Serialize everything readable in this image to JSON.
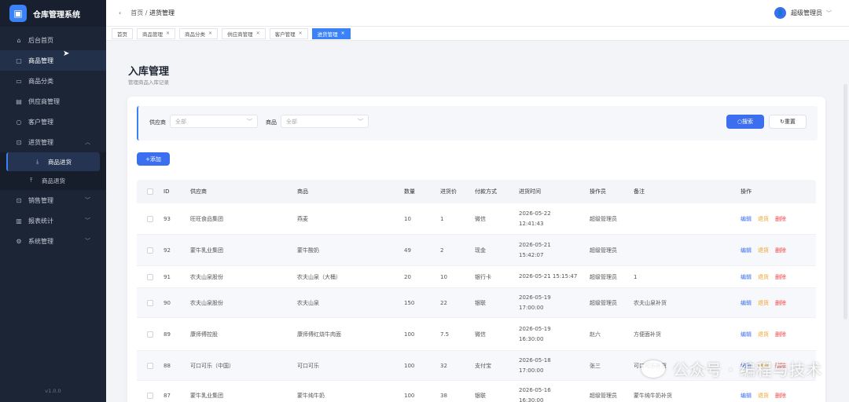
{
  "app": {
    "title": "仓库管理系统",
    "version": "v1.0.0"
  },
  "sidebar": {
    "items": [
      {
        "label": "后台首页",
        "icon": "home-icon"
      },
      {
        "label": "商品管理",
        "icon": "bag-icon"
      },
      {
        "label": "商品分类",
        "icon": "folder-icon"
      },
      {
        "label": "供应商管理",
        "icon": "truck-icon"
      },
      {
        "label": "客户管理",
        "icon": "user-icon"
      },
      {
        "label": "进货管理",
        "icon": "cart-icon"
      },
      {
        "label": "销售管理",
        "icon": "cart-icon"
      },
      {
        "label": "报表统计",
        "icon": "chart-icon"
      },
      {
        "label": "系统管理",
        "icon": "gear-icon"
      }
    ],
    "subitems": [
      {
        "label": "商品进货",
        "icon": "download-icon"
      },
      {
        "label": "商品退货",
        "icon": "upload-icon"
      }
    ]
  },
  "header": {
    "breadcrumb_home": "首页",
    "breadcrumb_sep": "/",
    "breadcrumb_current": "进货管理",
    "user": "超级管理员"
  },
  "tabs": [
    {
      "label": "首页",
      "closable": false
    },
    {
      "label": "商品管理",
      "closable": true
    },
    {
      "label": "商品分类",
      "closable": true
    },
    {
      "label": "供应商管理",
      "closable": true
    },
    {
      "label": "客户管理",
      "closable": true
    },
    {
      "label": "进货管理",
      "closable": true,
      "active": true
    }
  ],
  "page": {
    "title": "入库管理",
    "subtitle": "管理商品入库记录"
  },
  "filter": {
    "supplier_label": "供应商",
    "supplier_value": "全部",
    "product_label": "商品",
    "product_value": "全部",
    "search": "搜索",
    "reset": "重置"
  },
  "add_label": "+添加",
  "table": {
    "headers": [
      "ID",
      "供应商",
      "商品",
      "数量",
      "进货价",
      "付款方式",
      "进货时间",
      "操作员",
      "备注",
      "操作"
    ],
    "actions": {
      "edit": "编辑",
      "return": "退货",
      "delete": "删除"
    },
    "rows": [
      {
        "id": "93",
        "supplier": "旺旺食品集团",
        "product": "燕麦",
        "qty": "10",
        "price": "1",
        "pay": "微信",
        "time": "2026-05-22 12:41:43",
        "operator": "超级管理员",
        "note": ""
      },
      {
        "id": "92",
        "supplier": "蒙牛乳业集团",
        "product": "蒙牛酸奶",
        "qty": "49",
        "price": "2",
        "pay": "现金",
        "time": "2026-05-21 15:42:07",
        "operator": "超级管理员",
        "note": ""
      },
      {
        "id": "91",
        "supplier": "农夫山泉股份",
        "product": "农夫山泉（大桶）",
        "qty": "20",
        "price": "10",
        "pay": "银行卡",
        "time": "2026-05-21 15:15:47",
        "operator": "超级管理员",
        "note": "1"
      },
      {
        "id": "90",
        "supplier": "农夫山泉股份",
        "product": "农夫山泉",
        "qty": "150",
        "price": "22",
        "pay": "银联",
        "time": "2026-05-19 17:00:00",
        "operator": "超级管理员",
        "note": "农夫山泉补货"
      },
      {
        "id": "89",
        "supplier": "康师傅控股",
        "product": "康师傅红烧牛肉面",
        "qty": "100",
        "price": "7.5",
        "pay": "微信",
        "time": "2026-05-19 16:30:00",
        "operator": "赵六",
        "note": "方便面补货"
      },
      {
        "id": "88",
        "supplier": "可口可乐（中国）",
        "product": "可口可乐",
        "qty": "100",
        "price": "32",
        "pay": "支付宝",
        "time": "2026-05-18 17:00:00",
        "operator": "张三",
        "note": "可口可乐补货"
      },
      {
        "id": "87",
        "supplier": "蒙牛乳业集团",
        "product": "蒙牛纯牛奶",
        "qty": "100",
        "price": "38",
        "pay": "银联",
        "time": "2026-05-16 16:30:00",
        "operator": "超级管理员",
        "note": "蒙牛纯牛奶补货"
      }
    ]
  },
  "watermark": "公众号 · 编程与技术",
  "colors": {
    "primary": "#3b6ff0",
    "sidebar": "#1c2536",
    "return": "#f0a020",
    "delete": "#ef4444"
  }
}
